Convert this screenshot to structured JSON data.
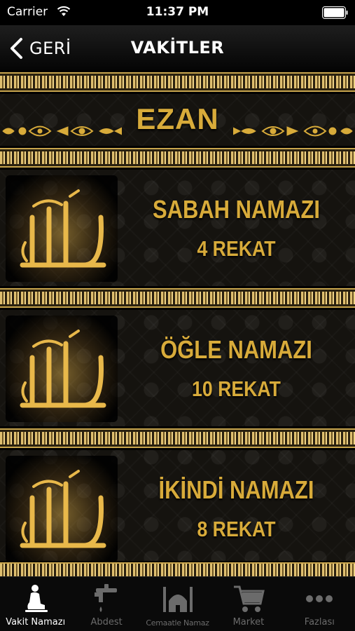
{
  "status_bar": {
    "carrier": "Carrier",
    "time": "11:37 PM"
  },
  "nav": {
    "back_label": "GERİ",
    "title": "VAKİTLER"
  },
  "ezan": {
    "title": "EZAN"
  },
  "prayers": [
    {
      "name": "SABAH NAMAZI",
      "rekat": "4 REKAT"
    },
    {
      "name": "ÖĞLE NAMAZI",
      "rekat": "10 REKAT"
    },
    {
      "name": "İKİNDİ NAMAZI",
      "rekat": "8 REKAT"
    }
  ],
  "tabs": [
    {
      "label": "Vakit Namazı",
      "icon": "praying-person-icon",
      "active": true
    },
    {
      "label": "Abdest",
      "icon": "faucet-icon",
      "active": false
    },
    {
      "label": "Cemaatle Namaz",
      "icon": "mosque-icon",
      "active": false
    },
    {
      "label": "Market",
      "icon": "cart-icon",
      "active": false
    },
    {
      "label": "Fazlası",
      "icon": "more-dots-icon",
      "active": false
    }
  ],
  "colors": {
    "gold": "#d8ab3a",
    "background": "#15130f",
    "tab_active": "#ffffff",
    "tab_inactive": "#6b6b6b"
  }
}
